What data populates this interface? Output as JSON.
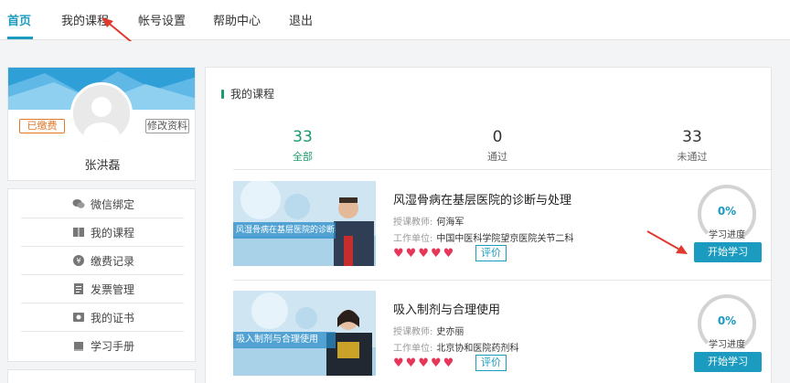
{
  "nav": {
    "items": [
      "首页",
      "我的课程",
      "帐号设置",
      "帮助中心",
      "退出"
    ]
  },
  "profile": {
    "paid_badge": "已缴费",
    "edit_label": "修改资料",
    "name": "张洪磊"
  },
  "menu": {
    "items": [
      {
        "label": "微信绑定",
        "icon": "wechat-icon"
      },
      {
        "label": "我的课程",
        "icon": "book-icon"
      },
      {
        "label": "缴费记录",
        "icon": "payment-icon"
      },
      {
        "label": "发票管理",
        "icon": "invoice-icon"
      },
      {
        "label": "我的证书",
        "icon": "certificate-icon"
      },
      {
        "label": "学习手册",
        "icon": "manual-icon"
      }
    ]
  },
  "main": {
    "section_title": "我的课程",
    "stats": [
      {
        "num": "33",
        "label": "全部"
      },
      {
        "num": "0",
        "label": "通过"
      },
      {
        "num": "33",
        "label": "未通过"
      }
    ],
    "courses": [
      {
        "title": "风湿骨病在基层医院的诊断与处理",
        "thumb_caption": "风湿骨病在基层医院的诊断与处理",
        "teacher_label": "授课教师:",
        "teacher": "何海军",
        "unit_label": "工作单位:",
        "unit": "中国中医科学院望京医院关节二科",
        "hearts": 5,
        "rate_label": "评价",
        "progress": "0%",
        "progress_label": "学习进度",
        "start_label": "开始学习"
      },
      {
        "title": "吸入制剂与合理使用",
        "thumb_caption": "吸入制剂与合理使用",
        "teacher_label": "授课教师:",
        "teacher": "史亦丽",
        "unit_label": "工作单位:",
        "unit": "北京协和医院药剂科",
        "hearts": 5,
        "rate_label": "评价",
        "progress": "0%",
        "progress_label": "学习进度",
        "start_label": "开始学习"
      }
    ]
  },
  "colors": {
    "accent": "#1b9bc0",
    "green": "#1b9b6c",
    "heart": "#e8365a",
    "arrow": "#e03a2f"
  }
}
